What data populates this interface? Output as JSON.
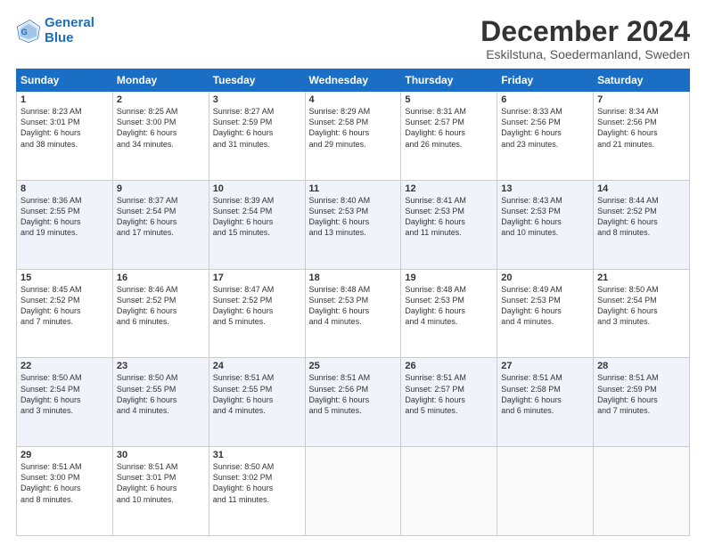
{
  "header": {
    "logo_line1": "General",
    "logo_line2": "Blue",
    "title": "December 2024",
    "subtitle": "Eskilstuna, Soedermanland, Sweden"
  },
  "weekdays": [
    "Sunday",
    "Monday",
    "Tuesday",
    "Wednesday",
    "Thursday",
    "Friday",
    "Saturday"
  ],
  "weeks": [
    [
      {
        "day": "1",
        "info": "Sunrise: 8:23 AM\nSunset: 3:01 PM\nDaylight: 6 hours\nand 38 minutes."
      },
      {
        "day": "2",
        "info": "Sunrise: 8:25 AM\nSunset: 3:00 PM\nDaylight: 6 hours\nand 34 minutes."
      },
      {
        "day": "3",
        "info": "Sunrise: 8:27 AM\nSunset: 2:59 PM\nDaylight: 6 hours\nand 31 minutes."
      },
      {
        "day": "4",
        "info": "Sunrise: 8:29 AM\nSunset: 2:58 PM\nDaylight: 6 hours\nand 29 minutes."
      },
      {
        "day": "5",
        "info": "Sunrise: 8:31 AM\nSunset: 2:57 PM\nDaylight: 6 hours\nand 26 minutes."
      },
      {
        "day": "6",
        "info": "Sunrise: 8:33 AM\nSunset: 2:56 PM\nDaylight: 6 hours\nand 23 minutes."
      },
      {
        "day": "7",
        "info": "Sunrise: 8:34 AM\nSunset: 2:56 PM\nDaylight: 6 hours\nand 21 minutes."
      }
    ],
    [
      {
        "day": "8",
        "info": "Sunrise: 8:36 AM\nSunset: 2:55 PM\nDaylight: 6 hours\nand 19 minutes."
      },
      {
        "day": "9",
        "info": "Sunrise: 8:37 AM\nSunset: 2:54 PM\nDaylight: 6 hours\nand 17 minutes."
      },
      {
        "day": "10",
        "info": "Sunrise: 8:39 AM\nSunset: 2:54 PM\nDaylight: 6 hours\nand 15 minutes."
      },
      {
        "day": "11",
        "info": "Sunrise: 8:40 AM\nSunset: 2:53 PM\nDaylight: 6 hours\nand 13 minutes."
      },
      {
        "day": "12",
        "info": "Sunrise: 8:41 AM\nSunset: 2:53 PM\nDaylight: 6 hours\nand 11 minutes."
      },
      {
        "day": "13",
        "info": "Sunrise: 8:43 AM\nSunset: 2:53 PM\nDaylight: 6 hours\nand 10 minutes."
      },
      {
        "day": "14",
        "info": "Sunrise: 8:44 AM\nSunset: 2:52 PM\nDaylight: 6 hours\nand 8 minutes."
      }
    ],
    [
      {
        "day": "15",
        "info": "Sunrise: 8:45 AM\nSunset: 2:52 PM\nDaylight: 6 hours\nand 7 minutes."
      },
      {
        "day": "16",
        "info": "Sunrise: 8:46 AM\nSunset: 2:52 PM\nDaylight: 6 hours\nand 6 minutes."
      },
      {
        "day": "17",
        "info": "Sunrise: 8:47 AM\nSunset: 2:52 PM\nDaylight: 6 hours\nand 5 minutes."
      },
      {
        "day": "18",
        "info": "Sunrise: 8:48 AM\nSunset: 2:53 PM\nDaylight: 6 hours\nand 4 minutes."
      },
      {
        "day": "19",
        "info": "Sunrise: 8:48 AM\nSunset: 2:53 PM\nDaylight: 6 hours\nand 4 minutes."
      },
      {
        "day": "20",
        "info": "Sunrise: 8:49 AM\nSunset: 2:53 PM\nDaylight: 6 hours\nand 4 minutes."
      },
      {
        "day": "21",
        "info": "Sunrise: 8:50 AM\nSunset: 2:54 PM\nDaylight: 6 hours\nand 3 minutes."
      }
    ],
    [
      {
        "day": "22",
        "info": "Sunrise: 8:50 AM\nSunset: 2:54 PM\nDaylight: 6 hours\nand 3 minutes."
      },
      {
        "day": "23",
        "info": "Sunrise: 8:50 AM\nSunset: 2:55 PM\nDaylight: 6 hours\nand 4 minutes."
      },
      {
        "day": "24",
        "info": "Sunrise: 8:51 AM\nSunset: 2:55 PM\nDaylight: 6 hours\nand 4 minutes."
      },
      {
        "day": "25",
        "info": "Sunrise: 8:51 AM\nSunset: 2:56 PM\nDaylight: 6 hours\nand 5 minutes."
      },
      {
        "day": "26",
        "info": "Sunrise: 8:51 AM\nSunset: 2:57 PM\nDaylight: 6 hours\nand 5 minutes."
      },
      {
        "day": "27",
        "info": "Sunrise: 8:51 AM\nSunset: 2:58 PM\nDaylight: 6 hours\nand 6 minutes."
      },
      {
        "day": "28",
        "info": "Sunrise: 8:51 AM\nSunset: 2:59 PM\nDaylight: 6 hours\nand 7 minutes."
      }
    ],
    [
      {
        "day": "29",
        "info": "Sunrise: 8:51 AM\nSunset: 3:00 PM\nDaylight: 6 hours\nand 8 minutes."
      },
      {
        "day": "30",
        "info": "Sunrise: 8:51 AM\nSunset: 3:01 PM\nDaylight: 6 hours\nand 10 minutes."
      },
      {
        "day": "31",
        "info": "Sunrise: 8:50 AM\nSunset: 3:02 PM\nDaylight: 6 hours\nand 11 minutes."
      },
      {
        "day": "",
        "info": ""
      },
      {
        "day": "",
        "info": ""
      },
      {
        "day": "",
        "info": ""
      },
      {
        "day": "",
        "info": ""
      }
    ]
  ]
}
